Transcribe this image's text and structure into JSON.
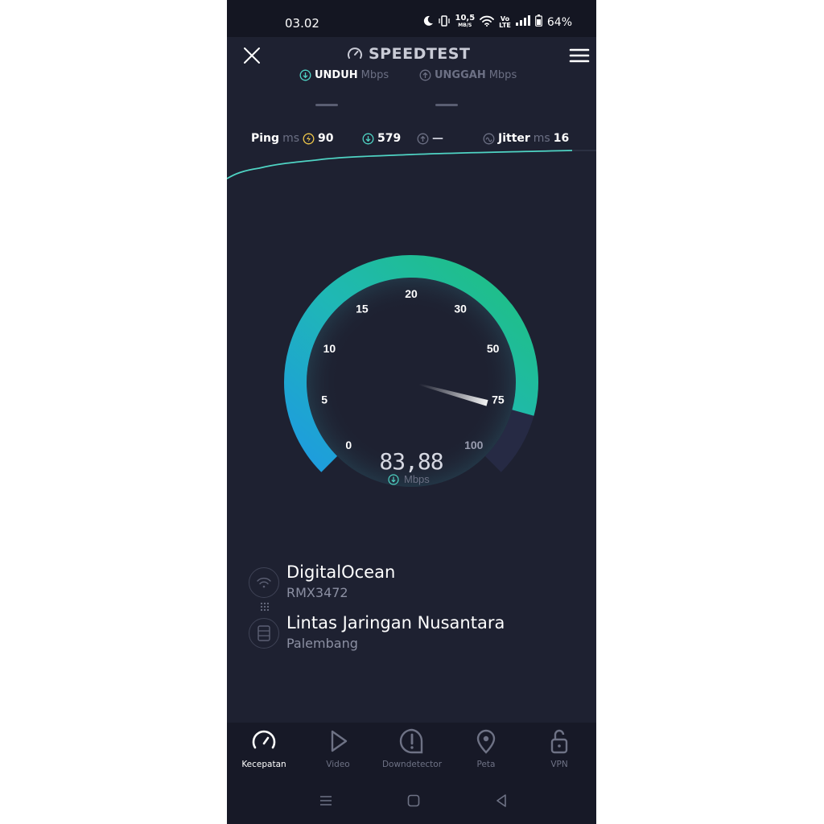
{
  "status_bar": {
    "time": "03.02",
    "net_speed_top": "10,5",
    "net_speed_unit": "MB/S",
    "volte_top": "Vo",
    "volte_bottom": "LTE",
    "battery": "64%"
  },
  "header": {
    "title": "SPEEDTEST"
  },
  "tabs": {
    "download": {
      "label": "UNDUH",
      "unit": "Mbps",
      "value": "—"
    },
    "upload": {
      "label": "UNGGAH",
      "unit": "Mbps",
      "value": "—"
    }
  },
  "metrics": {
    "ping_label": "Ping",
    "ping_unit": "ms",
    "ping_value": "90",
    "download_latency": "579",
    "upload_latency": "—",
    "jitter_label": "Jitter",
    "jitter_unit": "ms",
    "jitter_value": "16"
  },
  "gauge": {
    "ticks": [
      "0",
      "5",
      "10",
      "15",
      "20",
      "30",
      "50",
      "75",
      "100"
    ],
    "current_value": "83,88",
    "unit": "Mbps",
    "needle_fraction": 0.89,
    "colors": {
      "start": "#1e9be0",
      "mid": "#1fb8b4",
      "end": "#1fc07e"
    }
  },
  "isp": {
    "name": "DigitalOcean",
    "device": "RMX3472"
  },
  "server": {
    "name": "Lintas Jaringan Nusantara",
    "location": "Palembang"
  },
  "bottom_nav": [
    {
      "label": "Kecepatan",
      "icon": "speedometer-icon",
      "active": true
    },
    {
      "label": "Video",
      "icon": "play-icon",
      "active": false
    },
    {
      "label": "Downdetector",
      "icon": "alert-bubble-icon",
      "active": false
    },
    {
      "label": "Peta",
      "icon": "map-pin-icon",
      "active": false
    },
    {
      "label": "VPN",
      "icon": "lock-open-icon",
      "active": false
    }
  ],
  "accent_color": "#4fd4c4"
}
